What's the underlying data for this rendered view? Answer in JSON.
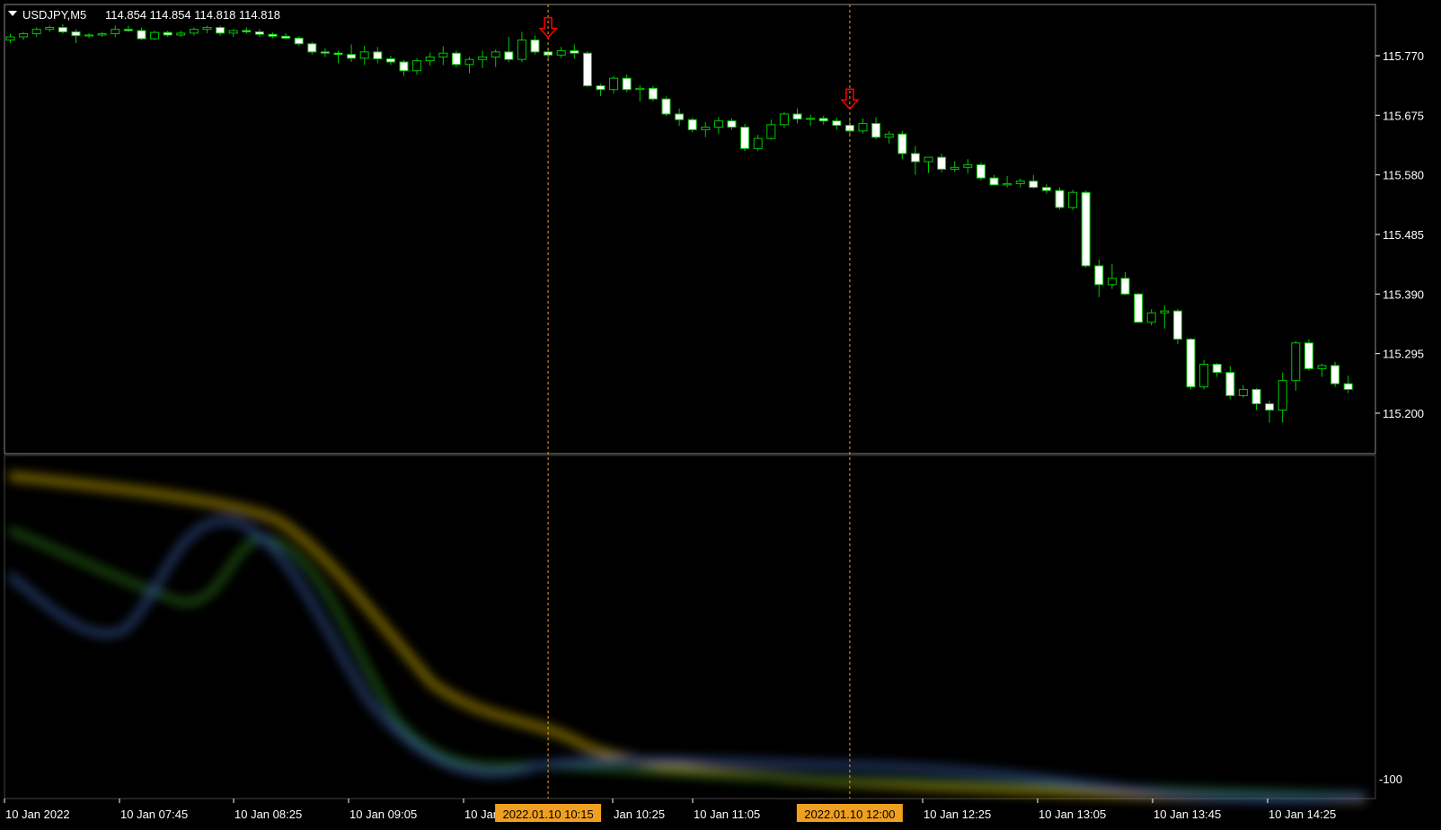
{
  "header": {
    "symbol": "USDJPY,M5",
    "ohlc": "114.854 114.854 114.818 114.818"
  },
  "colors": {
    "background": "#000000",
    "bull_candle": "#00c800",
    "bear_candle": "#ffffff",
    "axis": "#ffffff",
    "marker": "#ff0000",
    "vline": "#f0a020",
    "highlight_bg": "#f0a020",
    "indicator_yellow": "#d0b000",
    "indicator_green": "#3a9a20",
    "indicator_blue": "#4a70c0"
  },
  "chart_data": {
    "type": "candlestick",
    "symbol": "USDJPY",
    "timeframe": "M5",
    "y_axis_labels": [
      "115.770",
      "115.675",
      "115.580",
      "115.485",
      "115.390",
      "115.295",
      "115.200"
    ],
    "ylim": [
      115.16,
      115.84
    ],
    "x_axis_labels": [
      "10 Jan 2022",
      "10 Jan 07:45",
      "10 Jan 08:25",
      "10 Jan 09:05",
      "10 Jan",
      "Jan 10:25",
      "10 Jan 11:05",
      "10 Jan 12:25",
      "10 Jan 13:05",
      "10 Jan 13:45",
      "10 Jan 14:25"
    ],
    "highlighted_times": [
      "2022.01.10 10:15",
      "2022.01.10 12:00"
    ],
    "sell_markers": [
      {
        "time": "2022.01.10 10:15",
        "label": "2022.01.10 10:15"
      },
      {
        "time": "2022.01.10 12:00",
        "label": "2022.01.10 12:00"
      }
    ],
    "indicator_axis_label": "-100",
    "candles": [
      [
        115.795,
        115.805,
        115.79,
        115.8
      ],
      [
        115.8,
        115.808,
        115.795,
        115.805
      ],
      [
        115.805,
        115.815,
        115.8,
        115.812
      ],
      [
        115.812,
        115.818,
        115.808,
        115.815
      ],
      [
        115.815,
        115.82,
        115.805,
        115.808
      ],
      [
        115.808,
        115.812,
        115.79,
        115.802
      ],
      [
        115.802,
        115.806,
        115.798,
        115.803
      ],
      [
        115.803,
        115.808,
        115.8,
        115.805
      ],
      [
        115.805,
        115.818,
        115.8,
        115.812
      ],
      [
        115.812,
        115.818,
        115.808,
        115.81
      ],
      [
        115.81,
        115.815,
        115.795,
        115.797
      ],
      [
        115.797,
        115.81,
        115.795,
        115.807
      ],
      [
        115.807,
        115.81,
        115.8,
        115.803
      ],
      [
        115.803,
        115.81,
        115.8,
        115.806
      ],
      [
        115.806,
        115.815,
        115.802,
        115.812
      ],
      [
        115.812,
        115.818,
        115.806,
        115.815
      ],
      [
        115.815,
        115.818,
        115.802,
        115.806
      ],
      [
        115.806,
        115.812,
        115.8,
        115.81
      ],
      [
        115.81,
        115.815,
        115.805,
        115.808
      ],
      [
        115.808,
        115.812,
        115.8,
        115.804
      ],
      [
        115.804,
        115.807,
        115.798,
        115.801
      ],
      [
        115.801,
        115.806,
        115.796,
        115.798
      ],
      [
        115.798,
        115.801,
        115.786,
        115.789
      ],
      [
        115.789,
        115.792,
        115.772,
        115.776
      ],
      [
        115.776,
        115.782,
        115.768,
        115.774
      ],
      [
        115.774,
        115.778,
        115.758,
        115.772
      ],
      [
        115.772,
        115.788,
        115.76,
        115.766
      ],
      [
        115.766,
        115.786,
        115.755,
        115.776
      ],
      [
        115.776,
        115.784,
        115.758,
        115.765
      ],
      [
        115.765,
        115.77,
        115.755,
        115.76
      ],
      [
        115.76,
        115.763,
        115.738,
        115.746
      ],
      [
        115.746,
        115.766,
        115.74,
        115.762
      ],
      [
        115.762,
        115.775,
        115.754,
        115.768
      ],
      [
        115.768,
        115.785,
        115.755,
        115.774
      ],
      [
        115.774,
        115.778,
        115.752,
        115.756
      ],
      [
        115.756,
        115.768,
        115.742,
        115.764
      ],
      [
        115.764,
        115.778,
        115.75,
        115.768
      ],
      [
        115.768,
        115.78,
        115.752,
        115.776
      ],
      [
        115.776,
        115.8,
        115.76,
        115.764
      ],
      [
        115.764,
        115.808,
        115.76,
        115.795
      ],
      [
        115.795,
        115.802,
        115.772,
        115.776
      ],
      [
        115.776,
        115.782,
        115.762,
        115.771
      ],
      [
        115.771,
        115.784,
        115.766,
        115.778
      ],
      [
        115.778,
        115.788,
        115.765,
        115.774
      ],
      [
        115.774,
        115.777,
        115.72,
        115.722
      ],
      [
        115.722,
        115.725,
        115.706,
        115.716
      ],
      [
        115.716,
        115.737,
        115.71,
        115.734
      ],
      [
        115.734,
        115.74,
        115.712,
        115.716
      ],
      [
        115.716,
        115.723,
        115.697,
        115.718
      ],
      [
        115.718,
        115.722,
        115.697,
        115.701
      ],
      [
        115.701,
        115.705,
        115.674,
        115.677
      ],
      [
        115.677,
        115.686,
        115.658,
        115.668
      ],
      [
        115.668,
        115.671,
        115.648,
        115.652
      ],
      [
        115.652,
        115.664,
        115.64,
        115.656
      ],
      [
        115.656,
        115.672,
        115.645,
        115.666
      ],
      [
        115.666,
        115.67,
        115.652,
        115.656
      ],
      [
        115.656,
        115.661,
        115.618,
        115.622
      ],
      [
        115.622,
        115.644,
        115.618,
        115.638
      ],
      [
        115.638,
        115.668,
        115.636,
        115.66
      ],
      [
        115.66,
        115.68,
        115.655,
        115.677
      ],
      [
        115.677,
        115.686,
        115.662,
        115.669
      ],
      [
        115.669,
        115.676,
        115.658,
        115.67
      ],
      [
        115.67,
        115.674,
        115.66,
        115.666
      ],
      [
        115.666,
        115.671,
        115.652,
        115.659
      ],
      [
        115.659,
        115.668,
        115.645,
        115.65
      ],
      [
        115.65,
        115.67,
        115.646,
        115.662
      ],
      [
        115.662,
        115.672,
        115.637,
        115.64
      ],
      [
        115.64,
        115.65,
        115.63,
        115.645
      ],
      [
        115.645,
        115.65,
        115.605,
        115.614
      ],
      [
        115.614,
        115.626,
        115.58,
        115.601
      ],
      [
        115.601,
        115.606,
        115.583,
        115.608
      ],
      [
        115.608,
        115.614,
        115.584,
        115.589
      ],
      [
        115.589,
        115.602,
        115.585,
        115.592
      ],
      [
        115.592,
        115.605,
        115.582,
        115.596
      ],
      [
        115.596,
        115.6,
        115.571,
        115.575
      ],
      [
        115.575,
        115.58,
        115.563,
        115.564
      ],
      [
        115.564,
        115.578,
        115.56,
        115.566
      ],
      [
        115.566,
        115.574,
        115.56,
        115.57
      ],
      [
        115.57,
        115.58,
        115.558,
        115.56
      ],
      [
        115.56,
        115.565,
        115.55,
        115.555
      ],
      [
        115.555,
        115.56,
        115.525,
        115.528
      ],
      [
        115.528,
        115.556,
        115.524,
        115.552
      ],
      [
        115.552,
        115.555,
        115.432,
        115.435
      ],
      [
        115.435,
        115.445,
        115.385,
        115.405
      ],
      [
        115.405,
        115.438,
        115.398,
        115.415
      ],
      [
        115.415,
        115.425,
        115.388,
        115.39
      ],
      [
        115.39,
        115.392,
        115.345,
        115.345
      ],
      [
        115.345,
        115.366,
        115.34,
        115.36
      ],
      [
        115.36,
        115.372,
        115.335,
        115.363
      ],
      [
        115.363,
        115.366,
        115.31,
        115.318
      ],
      [
        115.318,
        115.32,
        115.238,
        115.242
      ],
      [
        115.242,
        115.285,
        115.238,
        115.278
      ],
      [
        115.278,
        115.28,
        115.258,
        115.265
      ],
      [
        115.265,
        115.275,
        115.222,
        115.228
      ],
      [
        115.228,
        115.245,
        115.225,
        115.238
      ],
      [
        115.238,
        115.24,
        115.205,
        115.215
      ],
      [
        115.215,
        115.22,
        115.185,
        115.205
      ],
      [
        115.205,
        115.265,
        115.185,
        115.252
      ],
      [
        115.252,
        115.315,
        115.236,
        115.312
      ],
      [
        115.312,
        115.318,
        115.268,
        115.271
      ],
      [
        115.271,
        115.279,
        115.258,
        115.276
      ],
      [
        115.276,
        115.282,
        115.242,
        115.247
      ],
      [
        115.247,
        115.26,
        115.232,
        115.238
      ]
    ]
  }
}
